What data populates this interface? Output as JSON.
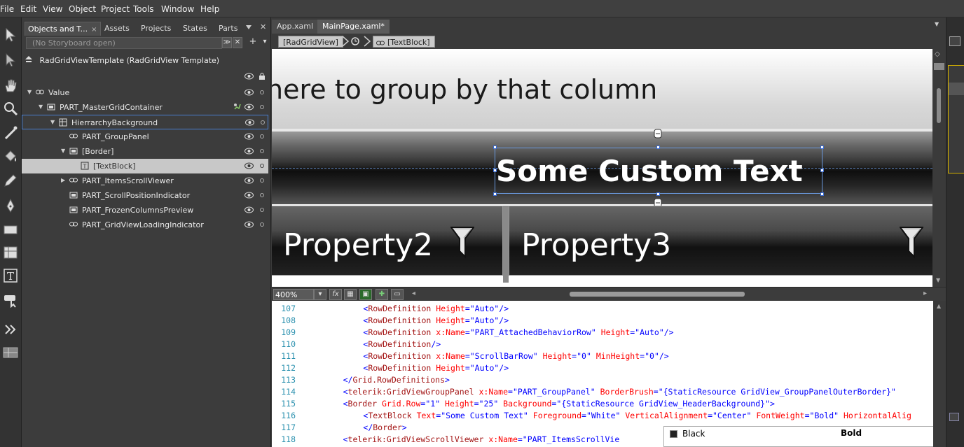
{
  "menu": [
    "File",
    "Edit",
    "View",
    "Object",
    "Project",
    "Tools",
    "Window",
    "Help"
  ],
  "objects_panel": {
    "tabs": [
      {
        "label": "Objects and T...",
        "close": "×"
      },
      {
        "label": "Assets"
      },
      {
        "label": "Projects"
      },
      {
        "label": "States"
      },
      {
        "label": "Parts"
      }
    ],
    "storyboard": "(No Storyboard open)",
    "template": "RadGridViewTemplate (RadGridView Template)",
    "tree": [
      {
        "label": "Value",
        "expanded": true,
        "level": 0
      },
      {
        "label": "PART_MasterGridContainer",
        "expanded": true,
        "level": 1
      },
      {
        "label": "HierrarchyBackground",
        "expanded": true,
        "level": 2
      },
      {
        "label": "PART_GroupPanel",
        "level": 3
      },
      {
        "label": "[Border]",
        "expanded": true,
        "level": 3
      },
      {
        "label": "[TextBlock]",
        "level": 4,
        "selected": true
      },
      {
        "label": "PART_ItemsScrollViewer",
        "level": 3
      },
      {
        "label": "PART_ScrollPositionIndicator",
        "level": 3
      },
      {
        "label": "PART_FrozenColumnsPreview",
        "level": 3
      },
      {
        "label": "PART_GridViewLoadingIndicator",
        "level": 3
      }
    ]
  },
  "doc_tabs": [
    "App.xaml",
    "MainPage.xaml*"
  ],
  "breadcrumbs": [
    "[RadGridView]",
    "[TextBlock]"
  ],
  "canvas": {
    "group_text": "here to group by that column",
    "custom_text": "Some Custom Text",
    "col1": "Property2",
    "col2": "Property3"
  },
  "zoom": "400%",
  "code": [
    {
      "n": "107",
      "indent": 12,
      "parts": [
        [
          "br",
          "<"
        ],
        [
          "tg",
          "RowDefinition"
        ],
        [
          "at",
          " Height"
        ],
        [
          "br",
          "=\""
        ],
        [
          "vl",
          "Auto"
        ],
        [
          "br",
          "\"/>"
        ]
      ]
    },
    {
      "n": "108",
      "indent": 12,
      "parts": [
        [
          "br",
          "<"
        ],
        [
          "tg",
          "RowDefinition"
        ],
        [
          "at",
          " Height"
        ],
        [
          "br",
          "=\""
        ],
        [
          "vl",
          "Auto"
        ],
        [
          "br",
          "\"/>"
        ]
      ]
    },
    {
      "n": "109",
      "indent": 12,
      "parts": [
        [
          "br",
          "<"
        ],
        [
          "tg",
          "RowDefinition"
        ],
        [
          "at",
          " x:Name"
        ],
        [
          "br",
          "=\""
        ],
        [
          "vl",
          "PART_AttachedBehaviorRow"
        ],
        [
          "br",
          "\""
        ],
        [
          "at",
          " Height"
        ],
        [
          "br",
          "=\""
        ],
        [
          "vl",
          "Auto"
        ],
        [
          "br",
          "\"/>"
        ]
      ]
    },
    {
      "n": "110",
      "indent": 12,
      "parts": [
        [
          "br",
          "<"
        ],
        [
          "tg",
          "RowDefinition"
        ],
        [
          "br",
          "/>"
        ]
      ]
    },
    {
      "n": "111",
      "indent": 12,
      "parts": [
        [
          "br",
          "<"
        ],
        [
          "tg",
          "RowDefinition"
        ],
        [
          "at",
          " x:Name"
        ],
        [
          "br",
          "=\""
        ],
        [
          "vl",
          "ScrollBarRow"
        ],
        [
          "br",
          "\""
        ],
        [
          "at",
          " Height"
        ],
        [
          "br",
          "=\""
        ],
        [
          "vl",
          "0"
        ],
        [
          "br",
          "\""
        ],
        [
          "at",
          " MinHeight"
        ],
        [
          "br",
          "=\""
        ],
        [
          "vl",
          "0"
        ],
        [
          "br",
          "\"/>"
        ]
      ]
    },
    {
      "n": "112",
      "indent": 12,
      "parts": [
        [
          "br",
          "<"
        ],
        [
          "tg",
          "RowDefinition"
        ],
        [
          "at",
          " Height"
        ],
        [
          "br",
          "=\""
        ],
        [
          "vl",
          "Auto"
        ],
        [
          "br",
          "\"/>"
        ]
      ]
    },
    {
      "n": "113",
      "indent": 8,
      "parts": [
        [
          "br",
          "</"
        ],
        [
          "tg",
          "Grid.RowDefinitions"
        ],
        [
          "br",
          ">"
        ]
      ]
    },
    {
      "n": "114",
      "indent": 8,
      "parts": [
        [
          "br",
          "<"
        ],
        [
          "tg",
          "telerik:GridViewGroupPanel"
        ],
        [
          "at",
          " x:Name"
        ],
        [
          "br",
          "=\""
        ],
        [
          "vl",
          "PART_GroupPanel"
        ],
        [
          "br",
          "\""
        ],
        [
          "at",
          " BorderBrush"
        ],
        [
          "br",
          "=\""
        ],
        [
          "vl",
          "{StaticResource GridView_GroupPanelOuterBorder}"
        ],
        [
          "br",
          "\""
        ]
      ]
    },
    {
      "n": "115",
      "indent": 8,
      "parts": [
        [
          "br",
          "<"
        ],
        [
          "tg",
          "Border"
        ],
        [
          "at",
          " Grid.Row"
        ],
        [
          "br",
          "=\""
        ],
        [
          "vl",
          "1"
        ],
        [
          "br",
          "\""
        ],
        [
          "at",
          " Height"
        ],
        [
          "br",
          "=\""
        ],
        [
          "vl",
          "25"
        ],
        [
          "br",
          "\""
        ],
        [
          "at",
          " Background"
        ],
        [
          "br",
          "=\""
        ],
        [
          "vl",
          "{StaticResource GridView_HeaderBackground}"
        ],
        [
          "br",
          "\">"
        ]
      ]
    },
    {
      "n": "116",
      "indent": 12,
      "parts": [
        [
          "br",
          "<"
        ],
        [
          "tg",
          "TextBlock"
        ],
        [
          "at",
          " Text"
        ],
        [
          "br",
          "=\""
        ],
        [
          "vl",
          "Some Custom Text"
        ],
        [
          "br",
          "\""
        ],
        [
          "at",
          " Foreground"
        ],
        [
          "br",
          "=\""
        ],
        [
          "vl",
          "White"
        ],
        [
          "br",
          "\""
        ],
        [
          "at",
          " VerticalAlignment"
        ],
        [
          "br",
          "=\""
        ],
        [
          "vl",
          "Center"
        ],
        [
          "br",
          "\""
        ],
        [
          "at",
          " FontWeight"
        ],
        [
          "br",
          "=\""
        ],
        [
          "vl",
          "Bold"
        ],
        [
          "br",
          "\""
        ],
        [
          "at",
          " HorizontalAlig"
        ]
      ]
    },
    {
      "n": "117",
      "indent": 12,
      "parts": [
        [
          "br",
          "</"
        ],
        [
          "tg",
          "Border"
        ],
        [
          "br",
          ">"
        ]
      ]
    },
    {
      "n": "118",
      "indent": 8,
      "parts": [
        [
          "br",
          "<"
        ],
        [
          "tg",
          "telerik:GridViewScrollViewer"
        ],
        [
          "at",
          " x:Name"
        ],
        [
          "br",
          "=\""
        ],
        [
          "vl",
          "PART_ItemsScrollVie"
        ]
      ]
    }
  ],
  "intellisense": {
    "item": "Black",
    "value": "Bold"
  }
}
